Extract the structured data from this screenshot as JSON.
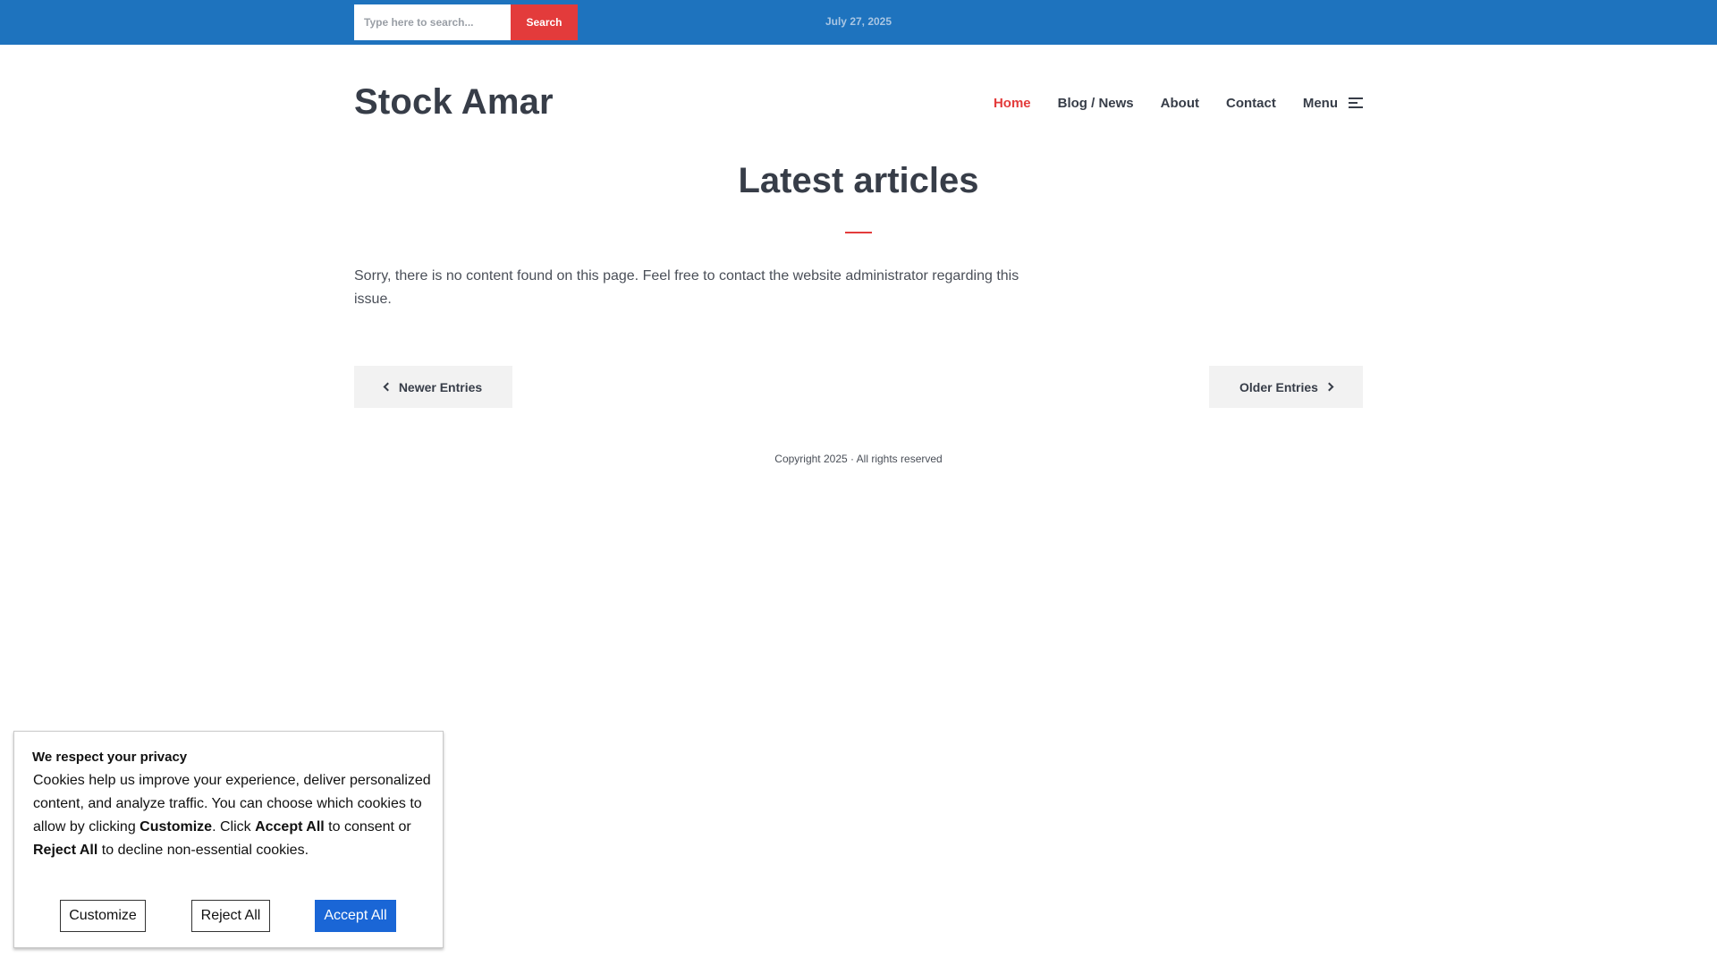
{
  "topbar": {
    "search_placeholder": "Type here to search...",
    "search_button": "Search",
    "date": "July 27, 2025"
  },
  "header": {
    "site_title": "Stock Amar",
    "nav": {
      "home": "Home",
      "blog": "Blog / News",
      "about": "About",
      "contact": "Contact",
      "menu": "Menu"
    }
  },
  "main": {
    "heading": "Latest articles",
    "no_content": "Sorry, there is no content found on this page. Feel free to contact the website administrator regarding this issue.",
    "newer": "Newer Entries",
    "older": "Older Entries"
  },
  "footer": {
    "copyright": "Copyright 2025 · All rights reserved"
  },
  "cookie": {
    "title": "We respect your privacy",
    "text_1": "Cookies help us improve your experience, deliver personalized content, and analyze traffic. You can choose which cookies to allow by clicking ",
    "bold_customize": "Customize",
    "text_2": ". Click ",
    "bold_accept": "Accept All",
    "text_3": " to consent or ",
    "bold_reject": "Reject All",
    "text_4": " to decline non-essential cookies.",
    "customize_button": "Customize",
    "reject_button": "Reject All",
    "accept_button": "Accept All"
  },
  "colors": {
    "topbar": "#1e73be",
    "accent": "#e33b3b",
    "accept": "#1a66d6"
  },
  "icons": {
    "menu": "hamburger-menu-icon",
    "newer": "chevron-left-icon",
    "older": "chevron-right-icon"
  }
}
